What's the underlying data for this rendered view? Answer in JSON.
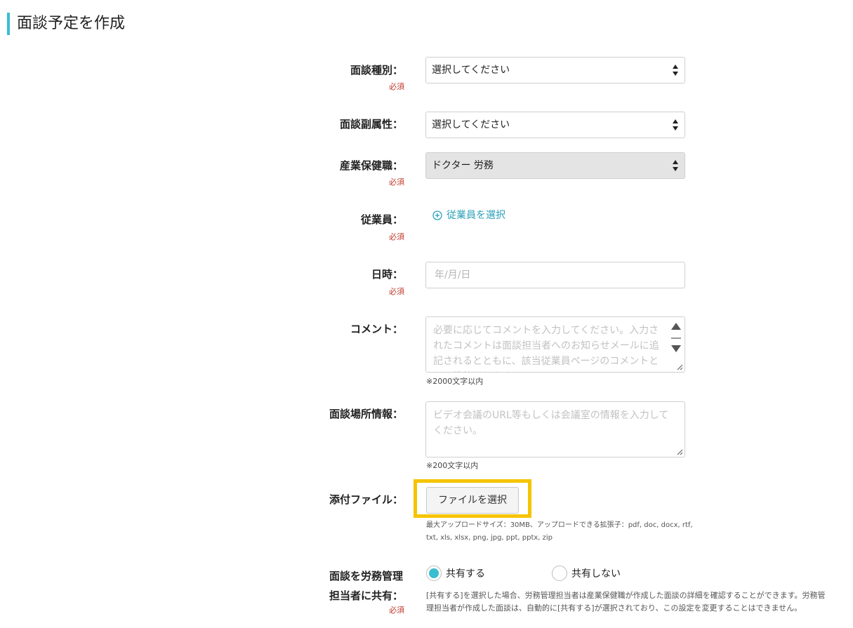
{
  "page": {
    "title": "面談予定を作成"
  },
  "form": {
    "required_text": "必須",
    "type": {
      "label": "面談種別：",
      "value": "選択してください"
    },
    "sub_attr": {
      "label": "面談副属性：",
      "value": "選択してください"
    },
    "doctor": {
      "label": "産業保健職：",
      "value": "ドクター 労務"
    },
    "employee": {
      "label": "従業員：",
      "link": "従業員を選択"
    },
    "datetime": {
      "label": "日時：",
      "placeholder": "年/月/日"
    },
    "comment": {
      "label": "コメント：",
      "placeholder": "必要に応じてコメントを入力してください。入力されたコメントは面談担当者へのお知らせメールに追記されるとともに、該当従業員ページのコメントとして投稿されます。",
      "hint": "※2000文字以内"
    },
    "location": {
      "label": "面談場所情報：",
      "placeholder": "ビデオ会議のURL等もしくは会議室の情報を入力してください。",
      "hint": "※200文字以内"
    },
    "attachment": {
      "label": "添付ファイル：",
      "button": "ファイルを選択",
      "hint": "最大アップロードサイズ：30MB、アップロードできる拡張子：pdf, doc, docx, rtf, txt, xls, xlsx, png, jpg, ppt, pptx, zip"
    },
    "share": {
      "label_line1": "面談を労務管理",
      "label_line2": "担当者に共有：",
      "option_yes": "共有する",
      "option_no": "共有しない",
      "selected": "共有する",
      "hint": "[共有する]を選択した場合、労務管理担当者は産業保健職が作成した面談の詳細を確認することができます。労務管理担当者が作成した面談は、自動的に[共有する]が選択されており、この設定を変更することはできません。"
    }
  },
  "colors": {
    "accent": "#3bbdd0",
    "required": "#c0392b",
    "highlight": "#f5c400",
    "link": "#2aa0b8"
  }
}
